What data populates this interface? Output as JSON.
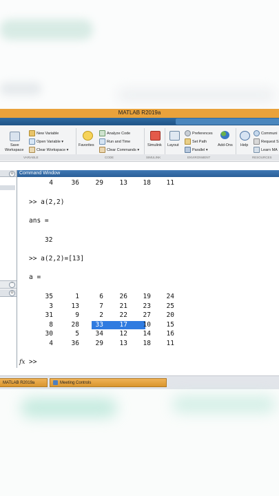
{
  "window": {
    "title": "MATLAB R2019a"
  },
  "ribbon": {
    "variable": {
      "save_workspace_line1": "Save",
      "save_workspace_line2": "Workspace",
      "new_variable": "New Variable",
      "open_variable": "Open Variable ▾",
      "clear_workspace": "Clear Workspace ▾"
    },
    "code": {
      "favorites": "Favorites",
      "analyze_code": "Analyze Code",
      "run_and_time": "Run and Time",
      "clear_commands": "Clear Commands ▾"
    },
    "simulink": {
      "simulink": "Simulink"
    },
    "environment": {
      "layout": "Layout",
      "preferences": "Preferences",
      "set_path": "Set Path",
      "parallel": "Parallel ▾",
      "addons": "Add-Ons"
    },
    "resources": {
      "help": "Help",
      "community": "Communi",
      "request_support": "Request S",
      "learn_matlab": "Learn MA"
    },
    "sections": {
      "variable": "VARIABLE",
      "code": "CODE",
      "simulink": "SIMULINK",
      "environment": "ENVIRONMENT",
      "resources": "RESOURCES"
    }
  },
  "command_window": {
    "title": "Command Window",
    "lines": {
      "row_prev": [
        "4",
        "36",
        "29",
        "13",
        "18",
        "11"
      ],
      "cmd1": ">> a(2,2)",
      "ans_label": "ans =",
      "ans_value": "32",
      "cmd2": ">> a(2,2)=[13]",
      "a_label": "a ="
    },
    "matrix": [
      [
        "35",
        "1",
        "6",
        "26",
        "19",
        "24"
      ],
      [
        "3",
        "13",
        "7",
        "21",
        "23",
        "25"
      ],
      [
        "31",
        "9",
        "2",
        "22",
        "27",
        "20"
      ],
      [
        "8",
        "28",
        "33",
        "17",
        "10",
        "15"
      ],
      [
        "30",
        "5",
        "34",
        "12",
        "14",
        "16"
      ],
      [
        "4",
        "36",
        "29",
        "13",
        "18",
        "11"
      ]
    ],
    "fx_symbol": "fx",
    "prompt": ">>"
  },
  "taskbar": {
    "item1": "MATLAB R2019a",
    "item2": "Meeting Controls"
  },
  "colors": {
    "titlebar": "#e9a23b",
    "selection": "#2f7be0",
    "panel_header": "#2b5f98"
  }
}
